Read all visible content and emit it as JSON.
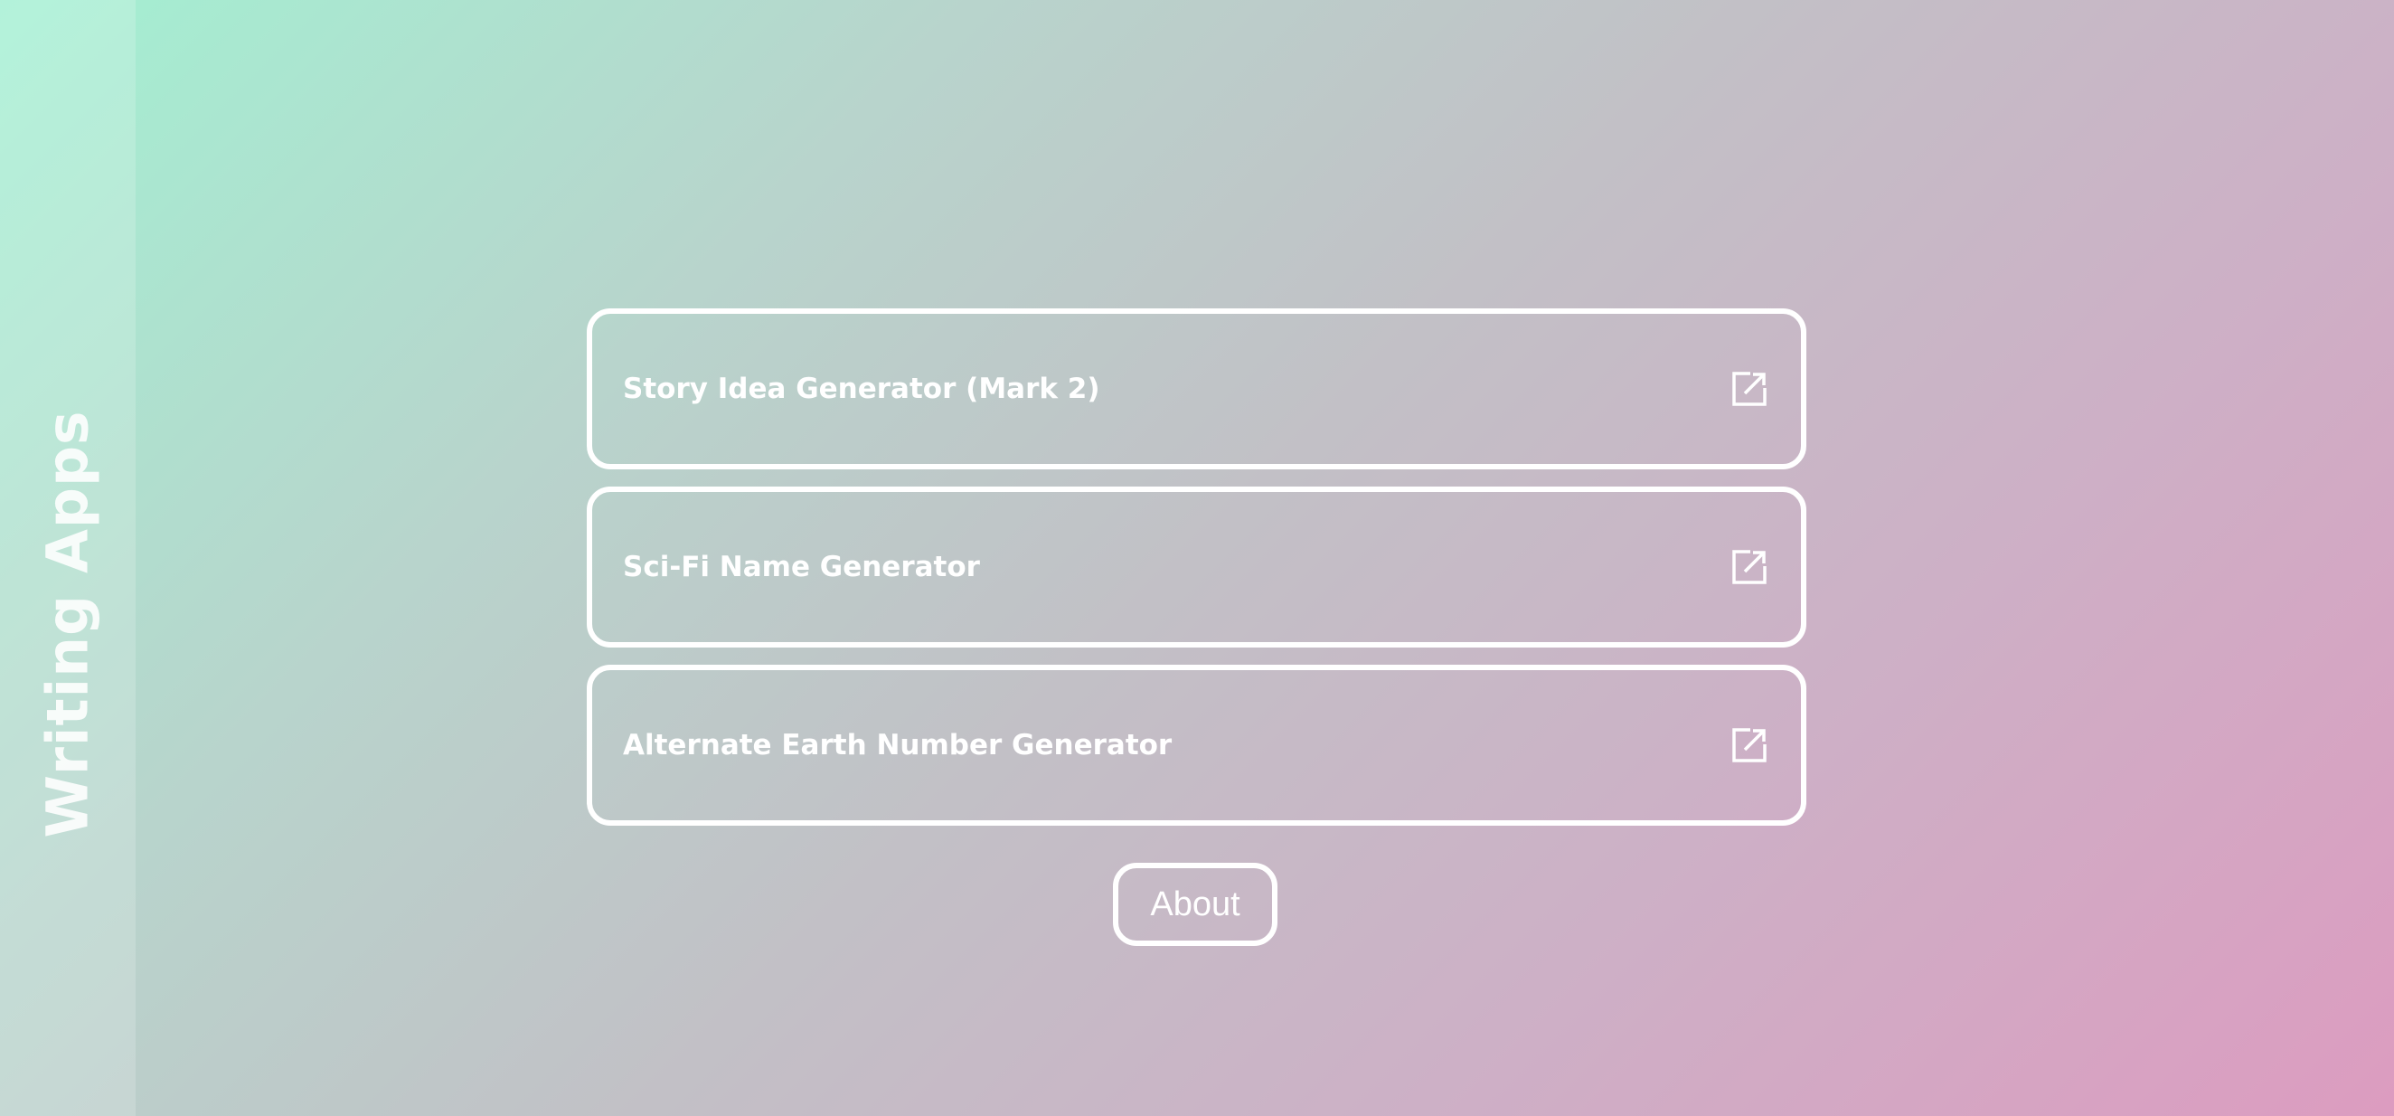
{
  "sidebar": {
    "title": "Writing Apps"
  },
  "apps": [
    {
      "label": "Story Idea Generator (Mark 2)",
      "icon": "external-link-icon"
    },
    {
      "label": "Sci-Fi Name Generator",
      "icon": "external-link-icon"
    },
    {
      "label": "Alternate Earth Number Generator",
      "icon": "external-link-icon"
    }
  ],
  "about_button": {
    "label": "About"
  },
  "colors": {
    "gradient_start": "#a3f0d2",
    "gradient_end": "#dc9cc0",
    "border": "#ffffff",
    "text": "#ffffff"
  }
}
